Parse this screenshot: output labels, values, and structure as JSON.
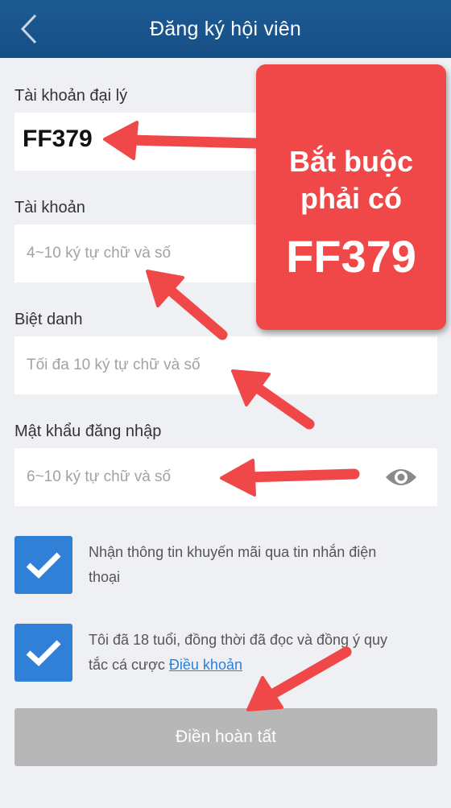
{
  "header": {
    "title": "Đăng ký hội viên",
    "back_icon": "chevron-left-icon"
  },
  "form": {
    "agent_account": {
      "label": "Tài khoản đại lý",
      "value": "FF379"
    },
    "account": {
      "label": "Tài khoản",
      "placeholder": "4~10 ký tự chữ và số"
    },
    "nickname": {
      "label": "Biệt danh",
      "placeholder": "Tối đa 10 ký tự chữ và số"
    },
    "password": {
      "label": "Mật khẩu đăng nhập",
      "placeholder": "6~10 ký tự chữ và số",
      "toggle_icon": "eye-icon"
    },
    "promo_checkbox": {
      "checked": true,
      "text": "Nhận thông tin khuyến mãi qua tin nhắn điện thoại"
    },
    "terms_checkbox": {
      "checked": true,
      "text": "Tôi đã 18 tuổi, đồng thời đã đọc và đồng ý quy tắc cá cược",
      "link": "Điều khoản"
    },
    "submit_label": "Điền hoàn tất"
  },
  "callout": {
    "line1": "Bắt buộc",
    "line2": "phải có",
    "code": "FF379"
  },
  "colors": {
    "header": "#1d5a93",
    "checkbox": "#2f80d6",
    "callout": "#f04848",
    "submit_disabled": "#b7b7b7",
    "background": "#eef0f3"
  }
}
